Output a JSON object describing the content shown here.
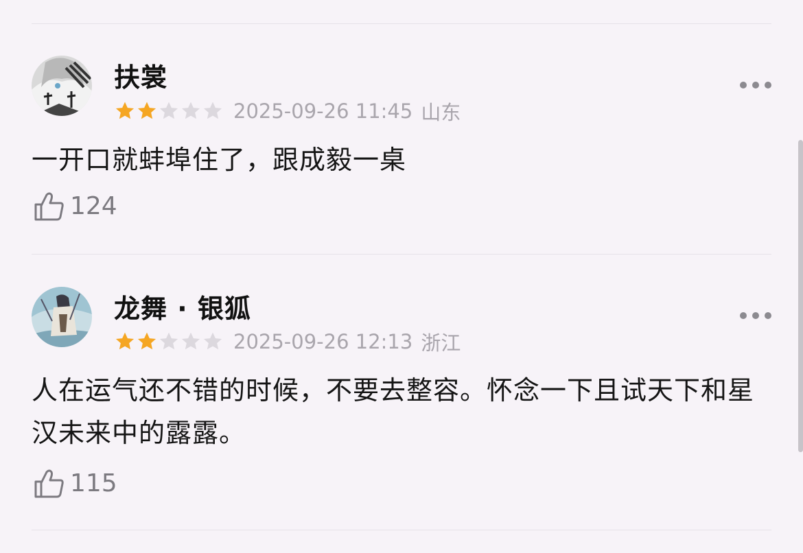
{
  "comments": [
    {
      "username": "扶裳",
      "rating": 2,
      "max_rating": 5,
      "timestamp": "2025-09-26 11:45",
      "location": "山东",
      "text": "一开口就蚌埠住了，跟成毅一桌",
      "likes": "124"
    },
    {
      "username": "龙舞 · 银狐",
      "rating": 2,
      "max_rating": 5,
      "timestamp": "2025-09-26 12:13",
      "location": "浙江",
      "text": "人在运气还不错的时候，不要去整容。怀念一下且试天下和星汉未来中的露露。",
      "likes": "115"
    }
  ],
  "colors": {
    "star_filled": "#f5a623",
    "star_empty": "#dcd8de",
    "meta_text": "#a9a5ac",
    "background": "#f7f3f8"
  },
  "icons": {
    "like": "thumbs-up-icon",
    "more": "more-options-icon"
  }
}
